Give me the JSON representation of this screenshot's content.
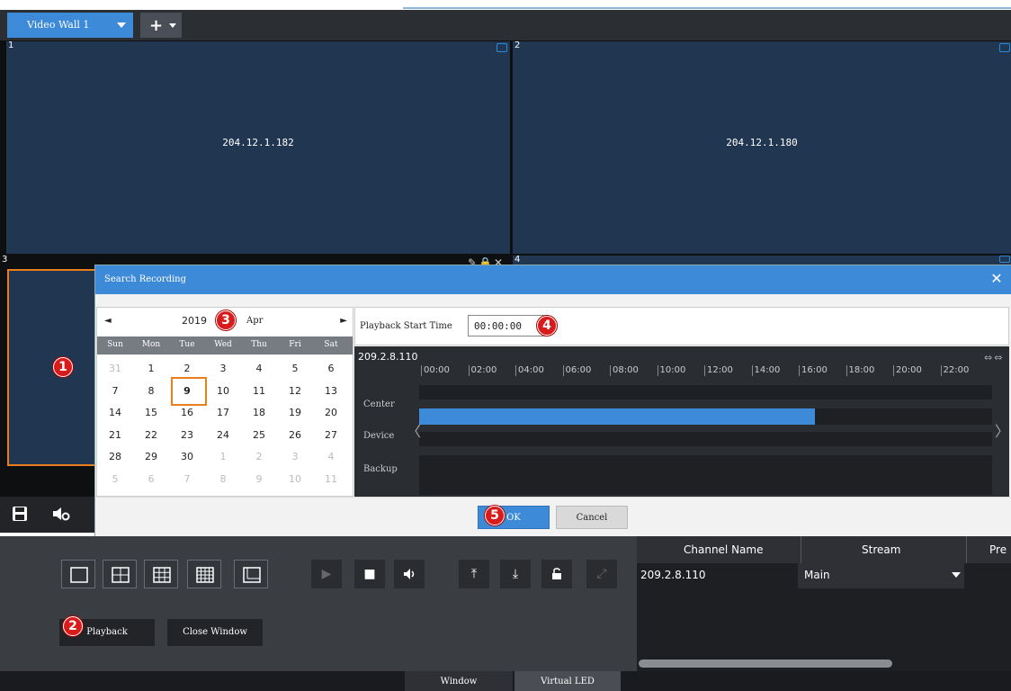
{
  "tab_bar": {
    "wall_tab_label": "Video Wall 1",
    "add_label": "+"
  },
  "windows": [
    {
      "number": "1",
      "ip": "204.12.1.182"
    },
    {
      "number": "2",
      "ip": "204.12.1.180"
    },
    {
      "number": "3",
      "ip": ""
    },
    {
      "number": "4",
      "ip": ""
    }
  ],
  "window3_tools": "✎🔒✕",
  "badges": [
    "1",
    "2",
    "3",
    "4",
    "5"
  ],
  "dialog": {
    "title": "Search Recording",
    "close": "✕",
    "calendar": {
      "prev": "◄",
      "next": "►",
      "year": "2019",
      "month": "Apr",
      "weekdays": [
        "Sun",
        "Mon",
        "Tue",
        "Wed",
        "Thu",
        "Fri",
        "Sat"
      ],
      "weeks": [
        [
          "31",
          "1",
          "2",
          "3",
          "4",
          "5",
          "6"
        ],
        [
          "7",
          "8",
          "9",
          "10",
          "11",
          "12",
          "13"
        ],
        [
          "14",
          "15",
          "16",
          "17",
          "18",
          "19",
          "20"
        ],
        [
          "21",
          "22",
          "23",
          "24",
          "25",
          "26",
          "27"
        ],
        [
          "28",
          "29",
          "30",
          "1",
          "2",
          "3",
          "4"
        ],
        [
          "5",
          "6",
          "7",
          "8",
          "9",
          "10",
          "11"
        ]
      ],
      "selected_day": "9"
    },
    "playback_start_label": "Playback Start Time",
    "playback_start_value": "00:00:00",
    "timeline": {
      "device": "209.2.8.110",
      "ticks": [
        "00:00",
        "02:00",
        "04:00",
        "06:00",
        "08:00",
        "10:00",
        "12:00",
        "14:00",
        "16:00",
        "18:00",
        "20:00",
        "22:00"
      ],
      "lanes": [
        "Center",
        "Device",
        "Backup"
      ],
      "zoom_icons": "⇔⇔",
      "left_arrow": "〈",
      "right_arrow": "〉",
      "device_recording_fraction": 0.69
    },
    "ok_label": "OK",
    "cancel_label": "Cancel"
  },
  "left_toolbar": {
    "save_icon": "💾",
    "settings_icon": "🔊"
  },
  "controls": {
    "play": "▶",
    "stop": "■",
    "audio": "◀)",
    "up": "⤒",
    "download": "⤓",
    "unlock": "🔓",
    "fullscreen": "⤢"
  },
  "playback_button": "Playback",
  "close_window_button": "Close Window",
  "channel_table": {
    "headers": [
      "Channel Name",
      "Stream",
      "Pre"
    ],
    "rows": [
      {
        "channel": "209.2.8.110",
        "stream": "Main"
      }
    ]
  },
  "bottom_tabs": [
    "Window",
    "Virtual LED"
  ],
  "colors": {
    "accent": "#3c8ad8",
    "highlight": "#e87e1c",
    "badge": "#d81c1c"
  }
}
